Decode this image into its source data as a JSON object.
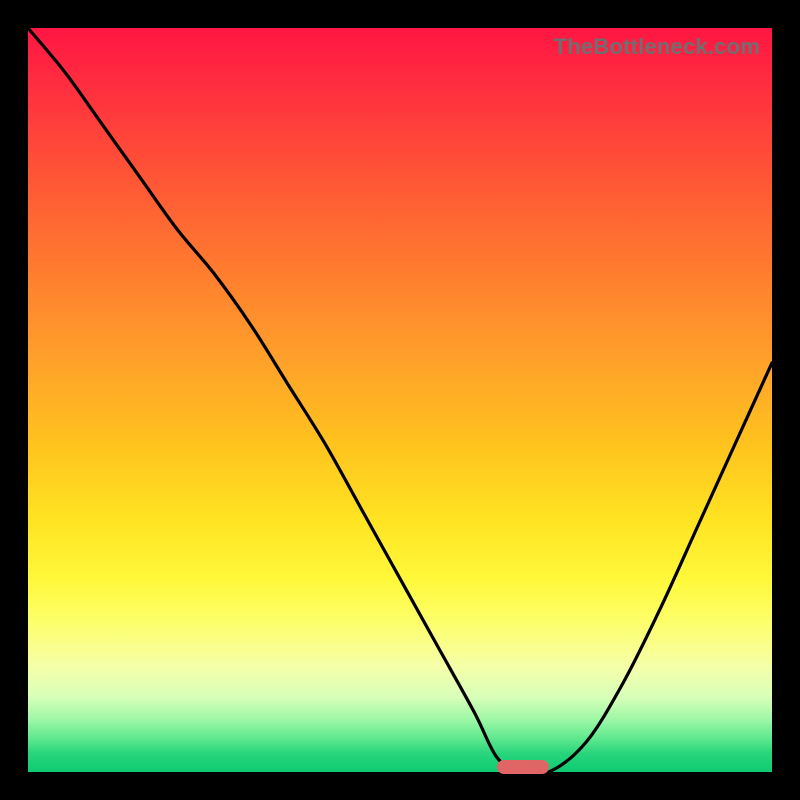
{
  "watermark": "TheBottleneck.com",
  "colors": {
    "frame": "#000000",
    "curve": "#000000",
    "marker": "#e06666",
    "gradient_top": "#ff1643",
    "gradient_bottom": "#0ecb72"
  },
  "chart_data": {
    "type": "line",
    "title": "",
    "xlabel": "",
    "ylabel": "",
    "xlim": [
      0,
      100
    ],
    "ylim": [
      0,
      100
    ],
    "grid": false,
    "legend": false,
    "x": [
      0,
      5,
      10,
      15,
      20,
      25,
      30,
      35,
      40,
      45,
      50,
      55,
      60,
      63,
      66,
      70,
      75,
      80,
      85,
      90,
      95,
      100
    ],
    "values": [
      100,
      94,
      87,
      80,
      73,
      67,
      60,
      52,
      44,
      35,
      26,
      17,
      8,
      2,
      0,
      0,
      4,
      12,
      22,
      33,
      44,
      55
    ],
    "marker": {
      "x_start": 63,
      "x_end": 70,
      "y": 0
    },
    "annotations": []
  }
}
